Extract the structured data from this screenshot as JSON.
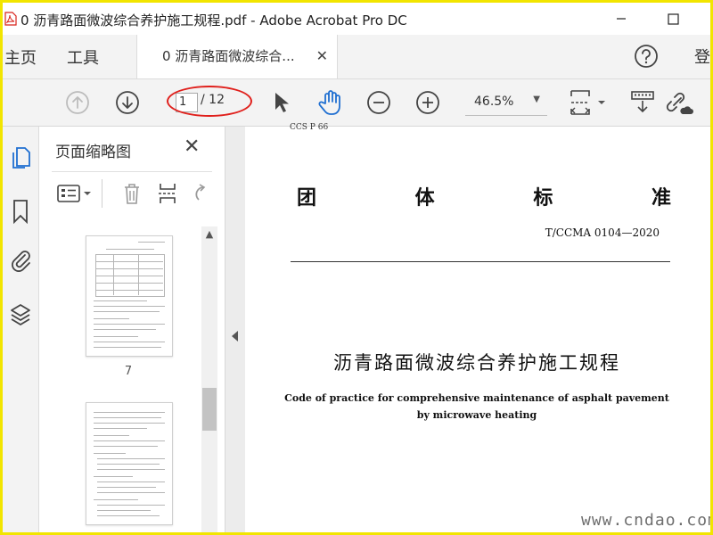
{
  "window": {
    "title": "0 沥青路面微波综合养护施工规程.pdf - Adobe Acrobat Pro DC"
  },
  "tabbar": {
    "home_label": "主页",
    "tools_label": "工具",
    "doc_tab_label": "0 沥青路面微波综合...",
    "login_label": "登"
  },
  "toolbar": {
    "current_page": "1",
    "page_total": "/ 12",
    "zoom_value": "46.5%"
  },
  "left_rail": {
    "icons": [
      "pages-icon",
      "bookmark-icon",
      "attachment-icon",
      "layers-icon"
    ]
  },
  "thumbnail_panel": {
    "title": "页面缩略图",
    "thumbnails": [
      {
        "page_label": "7"
      },
      {
        "page_label": ""
      }
    ]
  },
  "document": {
    "ccs_text": "CCS P 66",
    "standard_title_chars": [
      "团",
      "体",
      "标",
      "准"
    ],
    "standard_number": "T/CCMA 0104—2020",
    "title_zh": "沥青路面微波综合养护施工规程",
    "title_en_line1": "Code of practice for comprehensive maintenance of asphalt pavement",
    "title_en_line2": "by microwave heating"
  },
  "watermark": "www.cndao.com",
  "colors": {
    "frame_border": "#f2e500",
    "annotation_oval": "#e0201c",
    "hand_tool_blue": "#1f6fd1",
    "pdf_red": "#d8221b"
  }
}
